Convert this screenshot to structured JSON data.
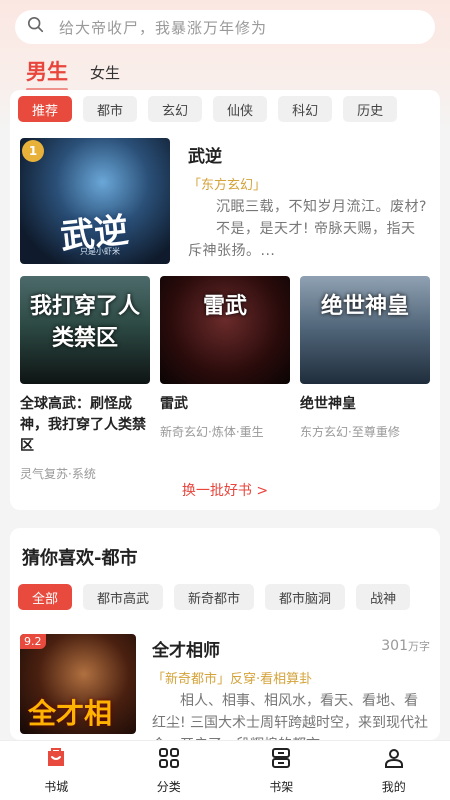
{
  "search": {
    "placeholder": "给大帝收尸，我暴涨万年修为"
  },
  "gender_tabs": [
    "男生",
    "女生"
  ],
  "categories": [
    "推荐",
    "都市",
    "玄幻",
    "仙侠",
    "科幻",
    "历史"
  ],
  "featured": {
    "rank": "1",
    "cover_title": "武逆",
    "cover_author": "只是小虾米",
    "title": "武逆",
    "tag": "「东方玄幻」",
    "desc1": "沉眠三载，不知岁月流江。废材?",
    "desc2": "不是，是天才! 帝脉天赐，指天斥神张扬。..."
  },
  "books": [
    {
      "cover_title": "我打穿了人类禁区",
      "title": "全球高武：刷怪成神，我打穿了人类禁区",
      "meta": "灵气复苏·系统"
    },
    {
      "cover_title": "雷武",
      "title": "雷武",
      "meta": "新奇玄幻·炼体·重生"
    },
    {
      "cover_title": "绝世神皇",
      "title": "绝世神皇",
      "meta": "东方玄幻·至尊重修"
    }
  ],
  "refresh_label": "换一批好书 >",
  "guess": {
    "title": "猜你喜欢-都市",
    "chips": [
      "全部",
      "都市高武",
      "新奇都市",
      "都市脑洞",
      "战神"
    ],
    "book": {
      "score": "9.2",
      "cover_title": "全才相师",
      "title": "全才相师",
      "word_count": "301",
      "word_unit": "万字",
      "tag": "「新奇都市」反穿·看相算卦",
      "desc": "相人、相事、相风水，看天、看地、看红尘! 三国大术士周轩跨越时空，来到现代社会，开启了一段辉煌的都市..."
    }
  },
  "nav": [
    {
      "label": "书城",
      "icon": "bookstore-icon"
    },
    {
      "label": "分类",
      "icon": "category-icon"
    },
    {
      "label": "书架",
      "icon": "bookshelf-icon"
    },
    {
      "label": "我的",
      "icon": "profile-icon"
    }
  ],
  "colors": {
    "accent": "#e84b3e",
    "tag": "#d4a33b"
  }
}
